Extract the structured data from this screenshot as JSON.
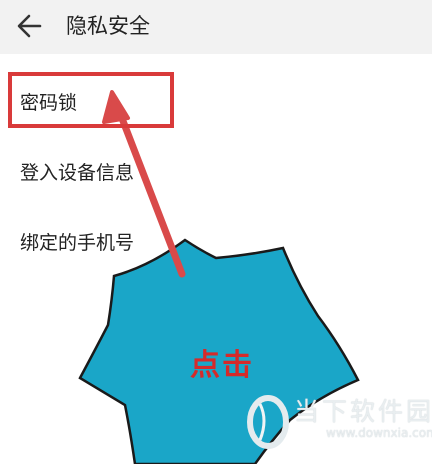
{
  "header": {
    "back_icon": "arrow-left-icon",
    "title": "隐私安全"
  },
  "menu": {
    "items": [
      {
        "label": "密码锁"
      },
      {
        "label": "登入设备信息"
      },
      {
        "label": "绑定的手机号"
      }
    ]
  },
  "annotation": {
    "click_label": "点击",
    "highlight_color": "#d93a3a",
    "burst_color": "#1aa6c8",
    "arrow_color": "#d94a4a"
  },
  "watermark": {
    "text": "当下软件园",
    "url": "www.downxia.com"
  }
}
